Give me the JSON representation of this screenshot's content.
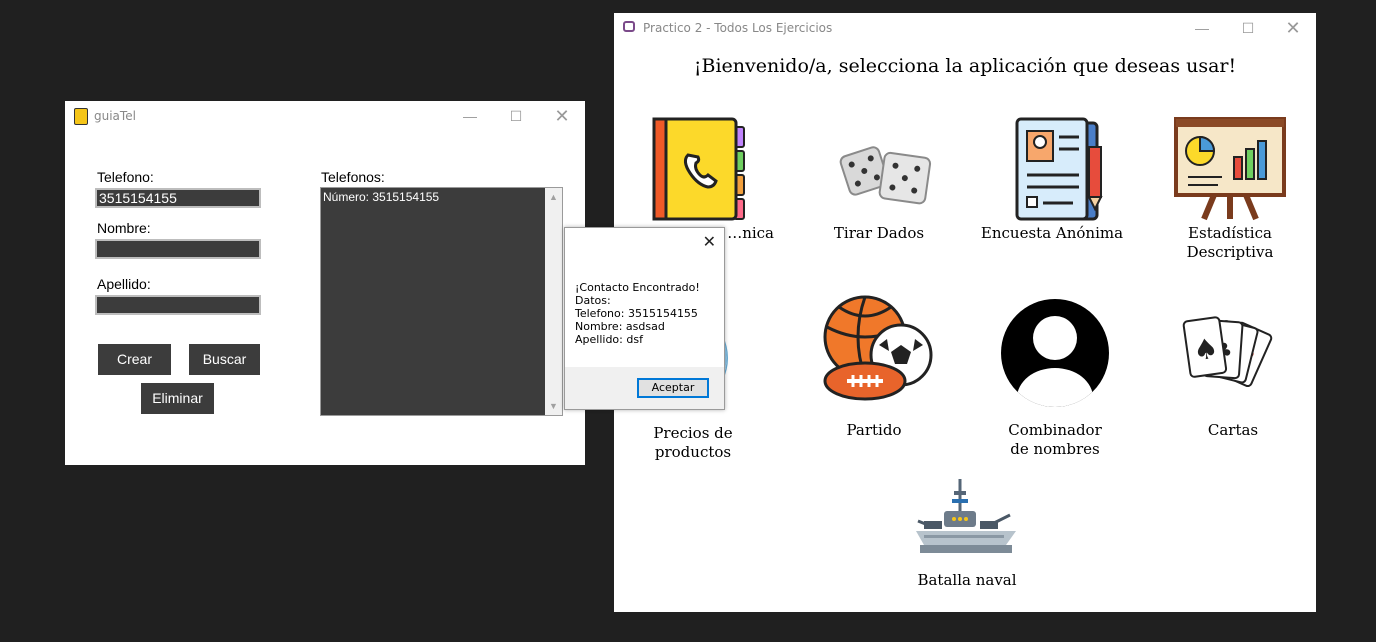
{
  "guia": {
    "title": "guiaTel",
    "telefono_label": "Telefono:",
    "telefono_value": "3515154155",
    "nombre_label": "Nombre:",
    "nombre_value": "",
    "apellido_label": "Apellido:",
    "apellido_value": "",
    "telefonos_label": "Telefonos:",
    "list_items": [
      "Número: 3515154155"
    ],
    "crear": "Crear",
    "buscar": "Buscar",
    "eliminar": "Eliminar"
  },
  "dialog": {
    "line1": "¡Contacto Encontrado!",
    "line2": "Datos:",
    "line3": "Telefono: 3515154155",
    "line4": "Nombre: asdsad",
    "line5": "Apellido: dsf",
    "accept": "Aceptar"
  },
  "practico": {
    "title": "Practico 2 - Todos Los Ejercicios",
    "heading": "¡Bienvenido/a, selecciona la aplicación que deseas usar!",
    "apps": {
      "agenda": {
        "label": "…nica",
        "icon": "phonebook-icon"
      },
      "dados": {
        "label": "Tirar Dados",
        "icon": "dice-icon"
      },
      "encuesta": {
        "label": "Encuesta Anónima",
        "icon": "survey-icon"
      },
      "estadistica": {
        "label1": "Estadística",
        "label2": "Descriptiva",
        "icon": "presentation-chart-icon"
      },
      "precios": {
        "label1": "Precios de",
        "label2": "productos",
        "icon": "price-icon"
      },
      "partido": {
        "label": "Partido",
        "icon": "sports-balls-icon"
      },
      "combinador": {
        "label1": "Combinador",
        "label2": "de nombres",
        "icon": "user-avatar-icon"
      },
      "cartas": {
        "label": "Cartas",
        "icon": "playing-cards-icon"
      },
      "batalla": {
        "label": "Batalla naval",
        "icon": "warship-icon"
      }
    }
  }
}
